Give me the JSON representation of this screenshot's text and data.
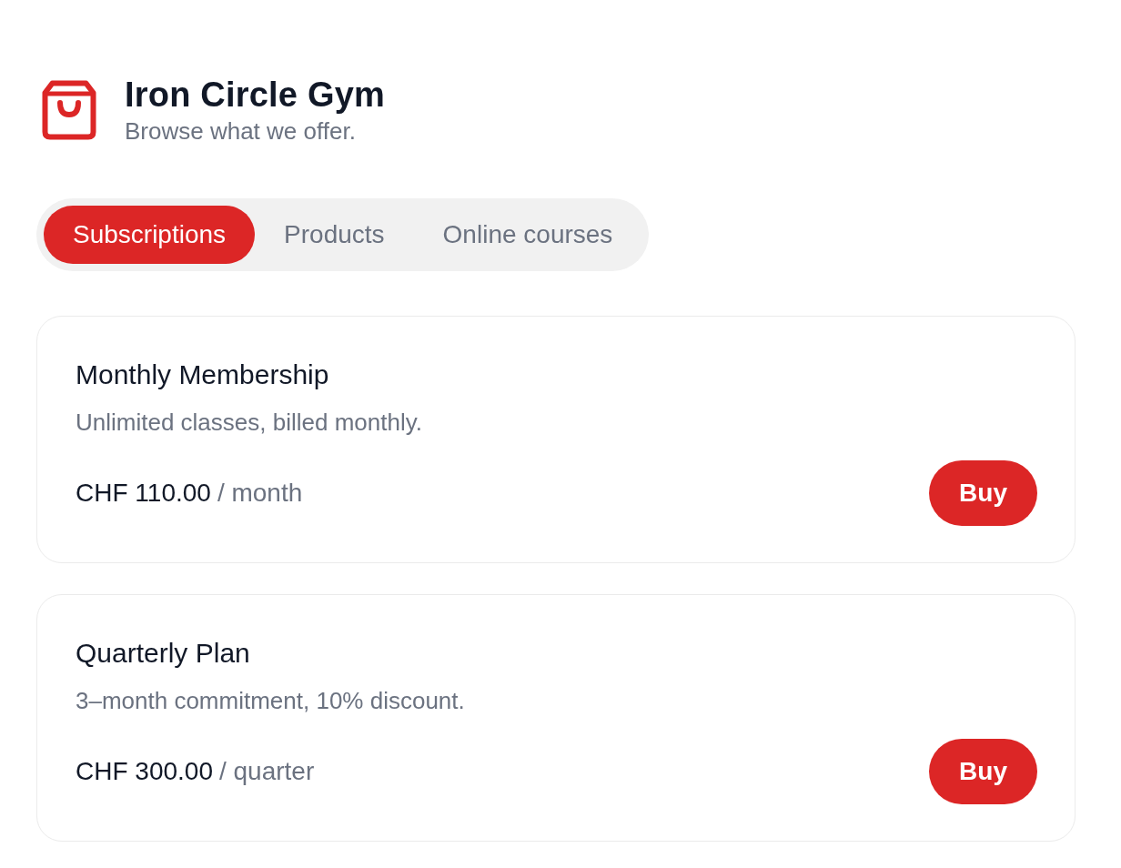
{
  "header": {
    "title": "Iron Circle Gym",
    "subtitle": "Browse what we offer."
  },
  "tabs": [
    {
      "label": "Subscriptions",
      "selected": true
    },
    {
      "label": "Products",
      "selected": false
    },
    {
      "label": "Online courses",
      "selected": false
    }
  ],
  "offers": [
    {
      "name": "Monthly Membership",
      "description": "Unlimited classes, billed monthly.",
      "price": "CHF 110.00",
      "period": "/ month",
      "button": "Buy"
    },
    {
      "name": "Quarterly Plan",
      "description": "3–month commitment, 10% discount.",
      "price": "CHF 300.00",
      "period": "/ quarter",
      "button": "Buy"
    }
  ]
}
